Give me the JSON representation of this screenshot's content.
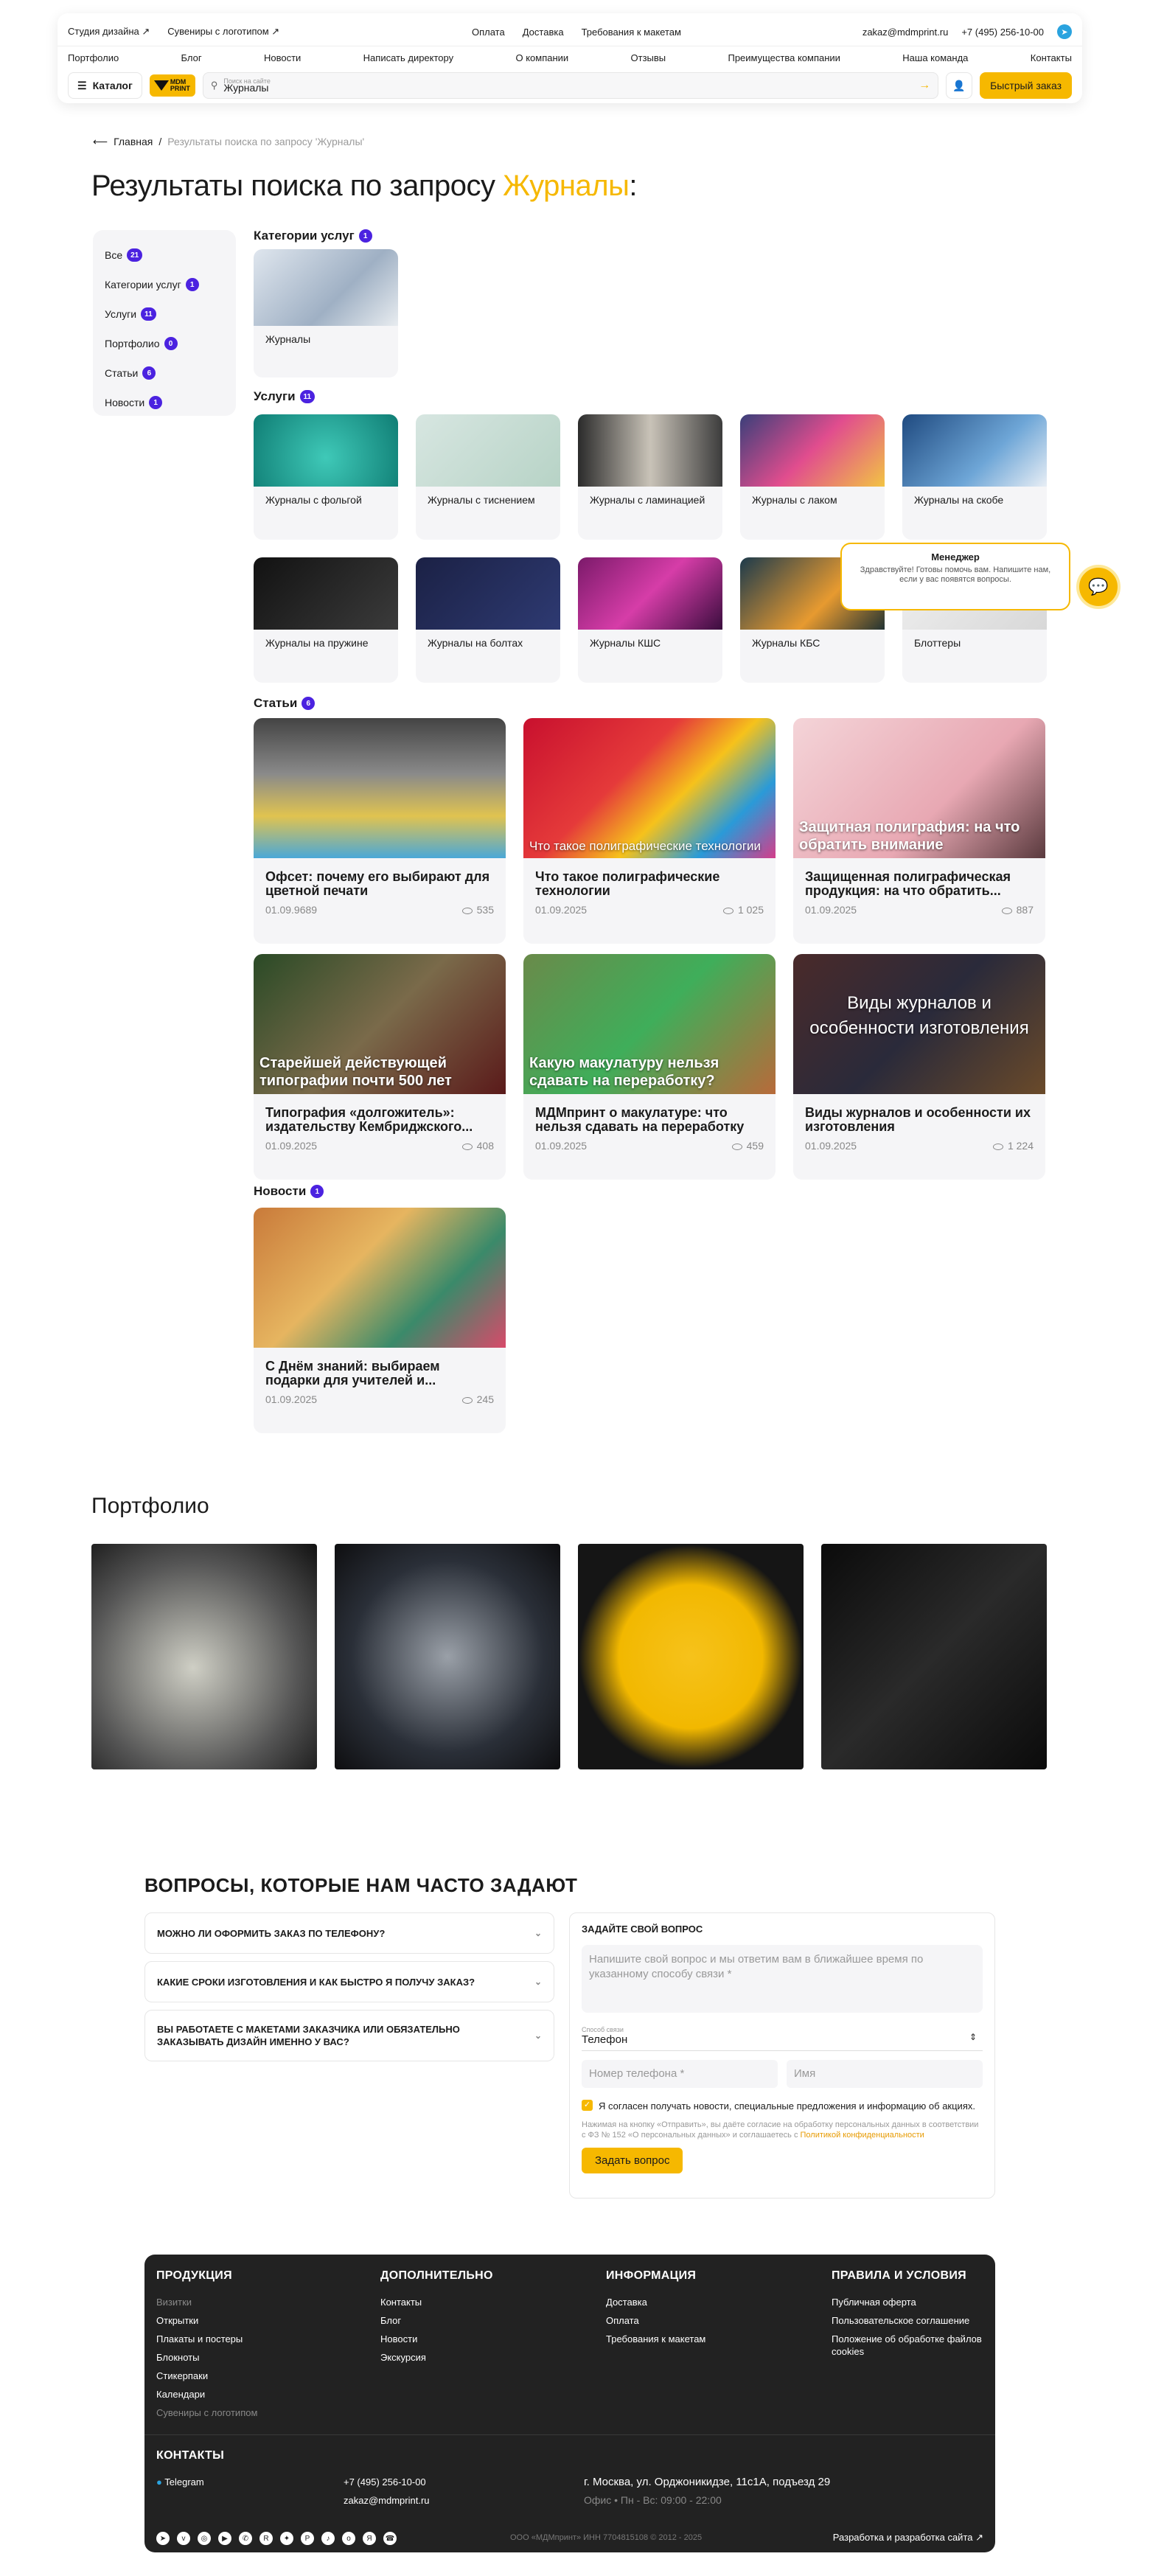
{
  "header": {
    "top_left": [
      "Студия дизайна ↗",
      "Сувениры с логотипом ↗"
    ],
    "top_mid": [
      "Оплата",
      "Доставка",
      "Требования к макетам"
    ],
    "email": "zakaz@mdmprint.ru",
    "phone": "+7 (495) 256-10-00",
    "nav": [
      "Портфолио",
      "Блог",
      "Новости",
      "Написать директору",
      "О компании",
      "Отзывы",
      "Преимущества компании",
      "Наша команда",
      "Контакты"
    ],
    "catalog": "Каталог",
    "logo": "MDM PRINT",
    "search_label": "Поиск на сайте",
    "search_value": "Журналы",
    "quick_order": "Быстрый заказ"
  },
  "breadcrumb": {
    "home": "Главная",
    "sep": "/",
    "current": "Результаты поиска по запросу 'Журналы'"
  },
  "title": {
    "prefix": "Результаты поиска по запросу ",
    "query": "Журналы",
    "suffix": ":"
  },
  "sidebar": [
    {
      "label": "Все",
      "count": "21"
    },
    {
      "label": "Категории услуг",
      "count": "1"
    },
    {
      "label": "Услуги",
      "count": "11"
    },
    {
      "label": "Портфолио",
      "count": "0"
    },
    {
      "label": "Статьи",
      "count": "6"
    },
    {
      "label": "Новости",
      "count": "1"
    }
  ],
  "sections": {
    "categories": {
      "label": "Категории услуг",
      "count": "1"
    },
    "services": {
      "label": "Услуги",
      "count": "11"
    },
    "articles": {
      "label": "Статьи",
      "count": "6"
    },
    "news": {
      "label": "Новости",
      "count": "1"
    }
  },
  "category_cards": [
    "Журналы"
  ],
  "services": [
    "Журналы с фольгой",
    "Журналы с тиснением",
    "Журналы с ламинацией",
    "Журналы с лаком",
    "Журналы на скобе",
    "Журналы на пружине",
    "Журналы на болтах",
    "Журналы КШС",
    "Журналы КБС",
    "Блоттеры"
  ],
  "articles": [
    {
      "title": "Офсет: почему его выбирают для цветной печати",
      "date": "01.09.9689",
      "views": "535",
      "overlay": ""
    },
    {
      "title": "Что такое полиграфические технологии",
      "date": "01.09.2025",
      "views": "1 025",
      "overlay": "Что такое полиграфические технологии"
    },
    {
      "title": "Защищенная полиграфическая продукция: на что обратить...",
      "date": "01.09.2025",
      "views": "887",
      "overlay": "Защитная полиграфия: на что обратить внимание"
    },
    {
      "title": "Типография «долгожитель»: издательству Кембриджского...",
      "date": "01.09.2025",
      "views": "408",
      "overlay": "Старейшей действующей типографии почти 500 лет"
    },
    {
      "title": "МДМпринт о макулатуре: что нельзя сдавать на переработку",
      "date": "01.09.2025",
      "views": "459",
      "overlay": "Какую макулатуру нельзя сдавать на переработку?"
    },
    {
      "title": "Виды журналов и особенности их изготовления",
      "date": "01.09.2025",
      "views": "1 224",
      "overlay": "Виды журналов и особенности изготовления"
    }
  ],
  "news": [
    {
      "title": "С Днём знаний: выбираем подарки для учителей и...",
      "date": "01.09.2025",
      "views": "245"
    }
  ],
  "portfolio_title": "Портфолио",
  "faq": {
    "title": "ВОПРОСЫ, КОТОРЫЕ НАМ ЧАСТО ЗАДАЮТ",
    "items": [
      "МОЖНО ЛИ ОФОРМИТЬ ЗАКАЗ ПО ТЕЛЕФОНУ?",
      "КАКИЕ СРОКИ ИЗГОТОВЛЕНИЯ И КАК БЫСТРО Я ПОЛУЧУ ЗАКАЗ?",
      "ВЫ РАБОТАЕТЕ С МАКЕТАМИ ЗАКАЗЧИКА ИЛИ ОБЯЗАТЕЛЬНО ЗАКАЗЫВАТЬ ДИЗАЙН ИМЕННО У ВАС?"
    ]
  },
  "form": {
    "title": "ЗАДАЙТЕ СВОЙ ВОПРОС",
    "question_ph": "Напишите свой вопрос и мы ответим вам в ближайшее время по указанному способу связи *",
    "contact_label": "Способ связи",
    "contact_value": "Телефон",
    "phone_ph": "Номер телефона *",
    "name_ph": "Имя",
    "consent": "Я согласен получать новости, специальные предложения и информацию об акциях.",
    "legal": "Нажимая на кнопку «Отправить», вы даёте согласие на обработку персональных данных в соответствии с ФЗ № 152 «О персональных данных» и соглашаетесь с ",
    "legal_link": "Политикой конфиденциальности",
    "submit": "Задать вопрос"
  },
  "footer": {
    "cols": [
      {
        "title": "ПРОДУКЦИЯ",
        "items": [
          "Визитки",
          "Открытки",
          "Плакаты и постеры",
          "Блокноты",
          "Стикерпаки",
          "Календари",
          "Сувениры с логотипом"
        ]
      },
      {
        "title": "ДОПОЛНИТЕЛЬНО",
        "items": [
          "Контакты",
          "Блог",
          "Новости",
          "Экскурсия"
        ]
      },
      {
        "title": "ИНФОРМАЦИЯ",
        "items": [
          "Доставка",
          "Оплата",
          "Требования к макетам"
        ]
      },
      {
        "title": "ПРАВИЛА И УСЛОВИЯ",
        "items": [
          "Публичная оферта",
          "Пользовательское соглашение",
          "Положение об обработке файлов cookies"
        ]
      }
    ],
    "contacts_title": "КОНТАКТЫ",
    "telegram": "Telegram",
    "phone": "+7 (495) 256-10-00",
    "email": "zakaz@mdmprint.ru",
    "address": "г. Москва, ул. Орджоникидзе, 11с1А, подъезд 29",
    "hours": "Офис • Пн - Вс: 09:00 - 22:00",
    "copyright": "ООО «МДМпринт»   ИНН 7704815108   © 2012 - 2025",
    "dev": "Разработка и разработка сайта ↗"
  },
  "chat": {
    "name": "Менеджер",
    "message": "Здравствуйте! Готовы помочь вам. Напишите нам, если у вас появятся вопросы."
  }
}
